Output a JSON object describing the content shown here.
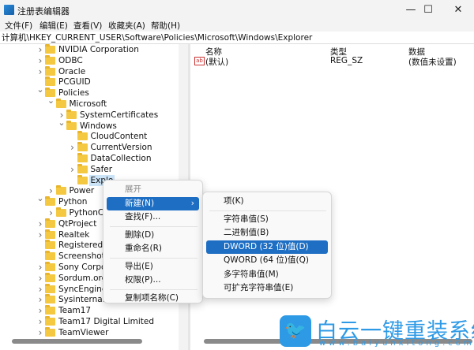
{
  "window": {
    "title": "注册表编辑器",
    "minimize": "—",
    "maximize": "☐",
    "close": "✕"
  },
  "menu": [
    "文件(F)",
    "编辑(E)",
    "查看(V)",
    "收藏夹(A)",
    "帮助(H)"
  ],
  "address": "计算机\\HKEY_CURRENT_USER\\Software\\Policies\\Microsoft\\Windows\\Explorer",
  "tree": [
    {
      "label": "NVIDIA Corporation",
      "level": 0,
      "chev": ">"
    },
    {
      "label": "ODBC",
      "level": 0,
      "chev": ">"
    },
    {
      "label": "Oracle",
      "level": 0,
      "chev": ">"
    },
    {
      "label": "PCGUID",
      "level": 0,
      "chev": ""
    },
    {
      "label": "Policies",
      "level": 0,
      "chev": "v"
    },
    {
      "label": "Microsoft",
      "level": 1,
      "chev": "v"
    },
    {
      "label": "SystemCertificates",
      "level": 2,
      "chev": ">"
    },
    {
      "label": "Windows",
      "level": 2,
      "chev": "v"
    },
    {
      "label": "CloudContent",
      "level": 3,
      "chev": ""
    },
    {
      "label": "CurrentVersion",
      "level": 3,
      "chev": ">"
    },
    {
      "label": "DataCollection",
      "level": 3,
      "chev": ""
    },
    {
      "label": "Safer",
      "level": 3,
      "chev": ">"
    },
    {
      "label": "Explo",
      "level": 3,
      "chev": "",
      "selected": true
    },
    {
      "label": "Power",
      "level": 1,
      "chev": ">"
    },
    {
      "label": "Python",
      "level": 0,
      "chev": "v"
    },
    {
      "label": "PythonCo",
      "level": 1,
      "chev": ">"
    },
    {
      "label": "QtProject",
      "level": 0,
      "chev": ">"
    },
    {
      "label": "Realtek",
      "level": 0,
      "chev": ">"
    },
    {
      "label": "RegisteredAp",
      "level": 0,
      "chev": ""
    },
    {
      "label": "Screenshot S",
      "level": 0,
      "chev": ""
    },
    {
      "label": "Sony Corpor",
      "level": 0,
      "chev": ">"
    },
    {
      "label": "Sordum.org",
      "level": 0,
      "chev": ">"
    },
    {
      "label": "SyncEngines",
      "level": 0,
      "chev": ">"
    },
    {
      "label": "Sysinternals",
      "level": 0,
      "chev": ">"
    },
    {
      "label": "Team17",
      "level": 0,
      "chev": ">"
    },
    {
      "label": "Team17 Digital Limited",
      "level": 0,
      "chev": ">"
    },
    {
      "label": "TeamViewer",
      "level": 0,
      "chev": ">"
    }
  ],
  "columns": {
    "name": "名称",
    "type": "类型",
    "data": "数据"
  },
  "values": [
    {
      "name": "(默认)",
      "type": "REG_SZ",
      "data": "(数值未设置)",
      "icon": "ab"
    }
  ],
  "context_menu": [
    {
      "label": "展开",
      "disabled": true
    },
    {
      "label": "新建(N)",
      "highlight": true,
      "submenu": true
    },
    {
      "label": "查找(F)..."
    },
    {
      "sep": true
    },
    {
      "label": "删除(D)"
    },
    {
      "label": "重命名(R)"
    },
    {
      "sep": true
    },
    {
      "label": "导出(E)"
    },
    {
      "label": "权限(P)..."
    },
    {
      "sep": true
    },
    {
      "label": "复制项名称(C)"
    }
  ],
  "submenu": [
    {
      "label": "项(K)"
    },
    {
      "sep": true
    },
    {
      "label": "字符串值(S)"
    },
    {
      "label": "二进制值(B)"
    },
    {
      "label": "DWORD (32 位)值(D)",
      "highlight": true
    },
    {
      "label": "QWORD (64 位)值(Q)"
    },
    {
      "label": "多字符串值(M)"
    },
    {
      "label": "可扩充字符串值(E)"
    }
  ],
  "watermark": {
    "text": "白云一键重装系统",
    "url": "www.baiyunxitong.com"
  },
  "colors": {
    "accent": "#1e6fc4",
    "watermark": "#2e9ae6"
  }
}
